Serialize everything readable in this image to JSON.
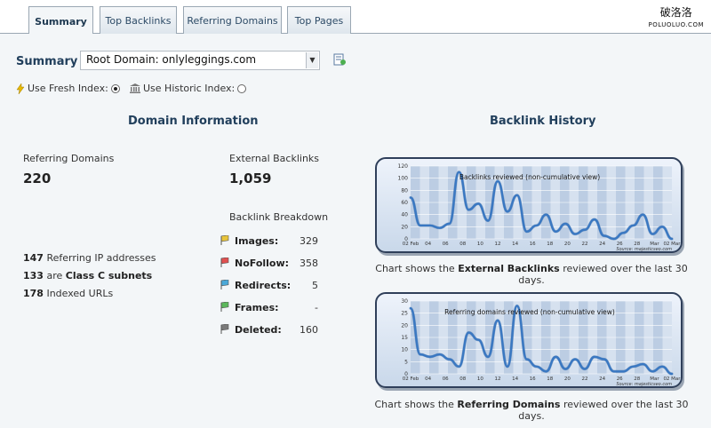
{
  "tabs": [
    {
      "label": "Summary",
      "active": true
    },
    {
      "label": "Top Backlinks",
      "active": false
    },
    {
      "label": "Referring Domains",
      "active": false
    },
    {
      "label": "Top Pages",
      "active": false
    }
  ],
  "logo": {
    "text": "破洛洛",
    "subtext": "POLUOLUO.COM"
  },
  "summary": {
    "label": "Summary",
    "select_value": "Root Domain: onlyleggings.com",
    "index_options": [
      {
        "label": "Use Fresh Index:",
        "selected": true,
        "icon": "lightning-icon"
      },
      {
        "label": "Use Historic Index:",
        "selected": false,
        "icon": "bank-icon"
      }
    ]
  },
  "domain_info": {
    "title": "Domain Information",
    "referring_domains_label": "Referring Domains",
    "referring_domains_value": "220",
    "external_backlinks_label": "External Backlinks",
    "external_backlinks_value": "1,059",
    "breakdown_title": "Backlink Breakdown",
    "breakdown": [
      {
        "name": "Images:",
        "value": "329",
        "color": "#e8c43a"
      },
      {
        "name": "NoFollow:",
        "value": "358",
        "color": "#e05050"
      },
      {
        "name": "Redirects:",
        "value": "5",
        "color": "#4aa8d8"
      },
      {
        "name": "Frames:",
        "value": "-",
        "color": "#5cb85c"
      },
      {
        "name": "Deleted:",
        "value": "160",
        "color": "#7a7a7a"
      }
    ],
    "lines": [
      {
        "num": "147",
        "pre": "Referring IP addresses",
        "bold": "",
        "post": ""
      },
      {
        "num": "133",
        "pre": "are ",
        "bold": "Class C subnets",
        "post": ""
      },
      {
        "num": "178",
        "pre": "Indexed URLs",
        "bold": "",
        "post": ""
      }
    ]
  },
  "backlink_history": {
    "title": "Backlink History",
    "captions": [
      {
        "pre": "Chart shows the ",
        "bold": "External Backlinks",
        "post": " reviewed over the last 30 days."
      },
      {
        "pre": "Chart shows the ",
        "bold": "Referring Domains",
        "post": " reviewed over the last 30 days."
      }
    ]
  },
  "chart_data": [
    {
      "type": "area",
      "title": "Backlinks reviewed (non-cumulative view)",
      "source": "Source: majesticseo.com",
      "ylim": [
        0,
        120
      ],
      "yticks": [
        0,
        20,
        40,
        60,
        80,
        100,
        120
      ],
      "xtick_labels": [
        "02 Feb",
        "04",
        "06",
        "08",
        "10",
        "12",
        "14",
        "16",
        "18",
        "20",
        "22",
        "24",
        "26",
        "28",
        "Mar",
        "02 Mar"
      ],
      "values": [
        68,
        22,
        22,
        18,
        25,
        110,
        48,
        58,
        30,
        95,
        45,
        72,
        12,
        22,
        40,
        12,
        25,
        8,
        15,
        32,
        5,
        0,
        10,
        22,
        40,
        8,
        20,
        0
      ],
      "color": "#3a78c2"
    },
    {
      "type": "area",
      "title": "Referring domains reviewed (non-cumulative view)",
      "source": "Source: majesticseo.com",
      "ylim": [
        0,
        30
      ],
      "yticks": [
        0,
        5,
        10,
        15,
        20,
        25,
        30
      ],
      "xtick_labels": [
        "02 Feb",
        "04",
        "06",
        "08",
        "10",
        "12",
        "14",
        "16",
        "18",
        "20",
        "22",
        "24",
        "26",
        "28",
        "Mar",
        "02 Mar"
      ],
      "values": [
        27,
        8,
        7,
        8,
        6,
        3,
        17,
        14,
        7,
        22,
        3,
        28,
        6,
        3,
        1,
        7,
        2,
        6,
        2,
        7,
        6,
        1,
        1,
        3,
        4,
        1,
        3,
        0
      ],
      "color": "#3a78c2"
    }
  ]
}
